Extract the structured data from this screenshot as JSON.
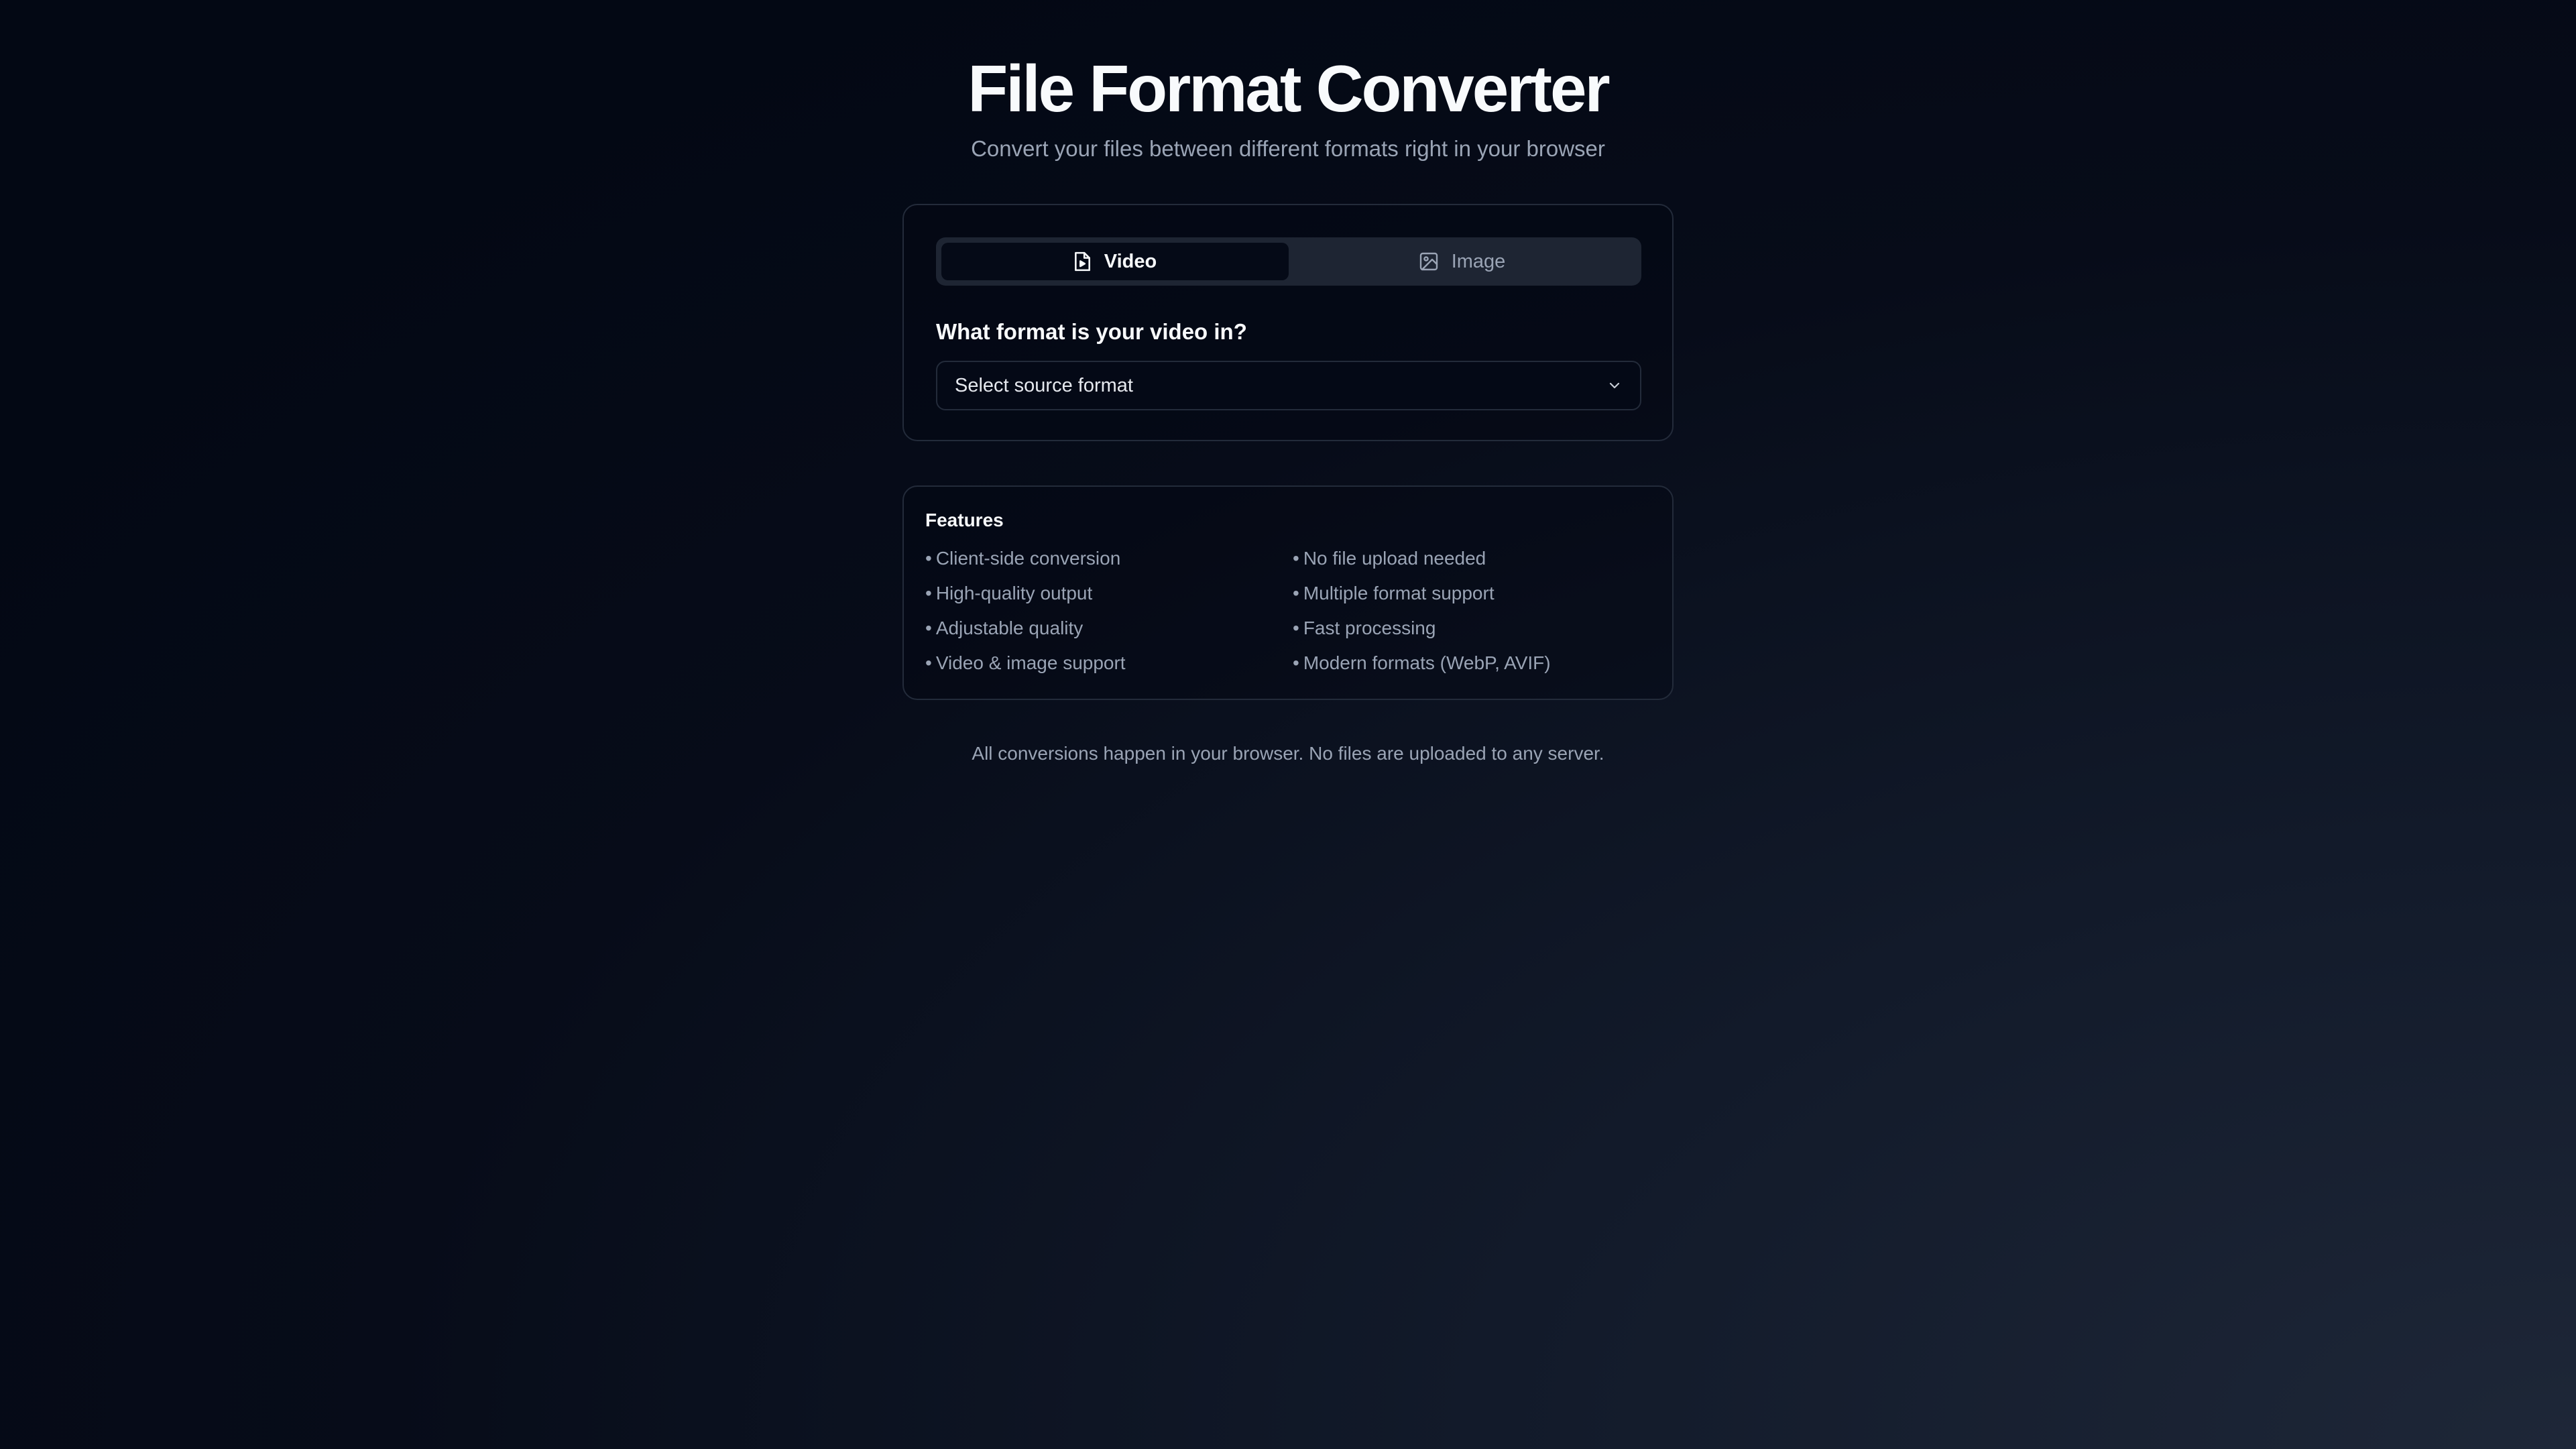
{
  "header": {
    "title": "File Format Converter",
    "subtitle": "Convert your files between different formats right in your browser"
  },
  "converter": {
    "tabs": [
      {
        "label": "Video",
        "icon": "file-video-icon",
        "active": true
      },
      {
        "label": "Image",
        "icon": "image-icon",
        "active": false
      }
    ],
    "question": "What format is your video in?",
    "source_select": {
      "placeholder": "Select source format"
    }
  },
  "features": {
    "title": "Features",
    "bullet": "•",
    "items": [
      "Client-side conversion",
      "No file upload needed",
      "High-quality output",
      "Multiple format support",
      "Adjustable quality",
      "Fast processing",
      "Video & image support",
      "Modern formats (WebP, AVIF)"
    ]
  },
  "footer": {
    "note": "All conversions happen in your browser. No files are uploaded to any server."
  },
  "colors": {
    "background": "#030814",
    "card_border": "#232b3a",
    "muted_text": "#9aa4b5",
    "tab_bar": "#1e2533",
    "active_tab": "#050a17"
  }
}
